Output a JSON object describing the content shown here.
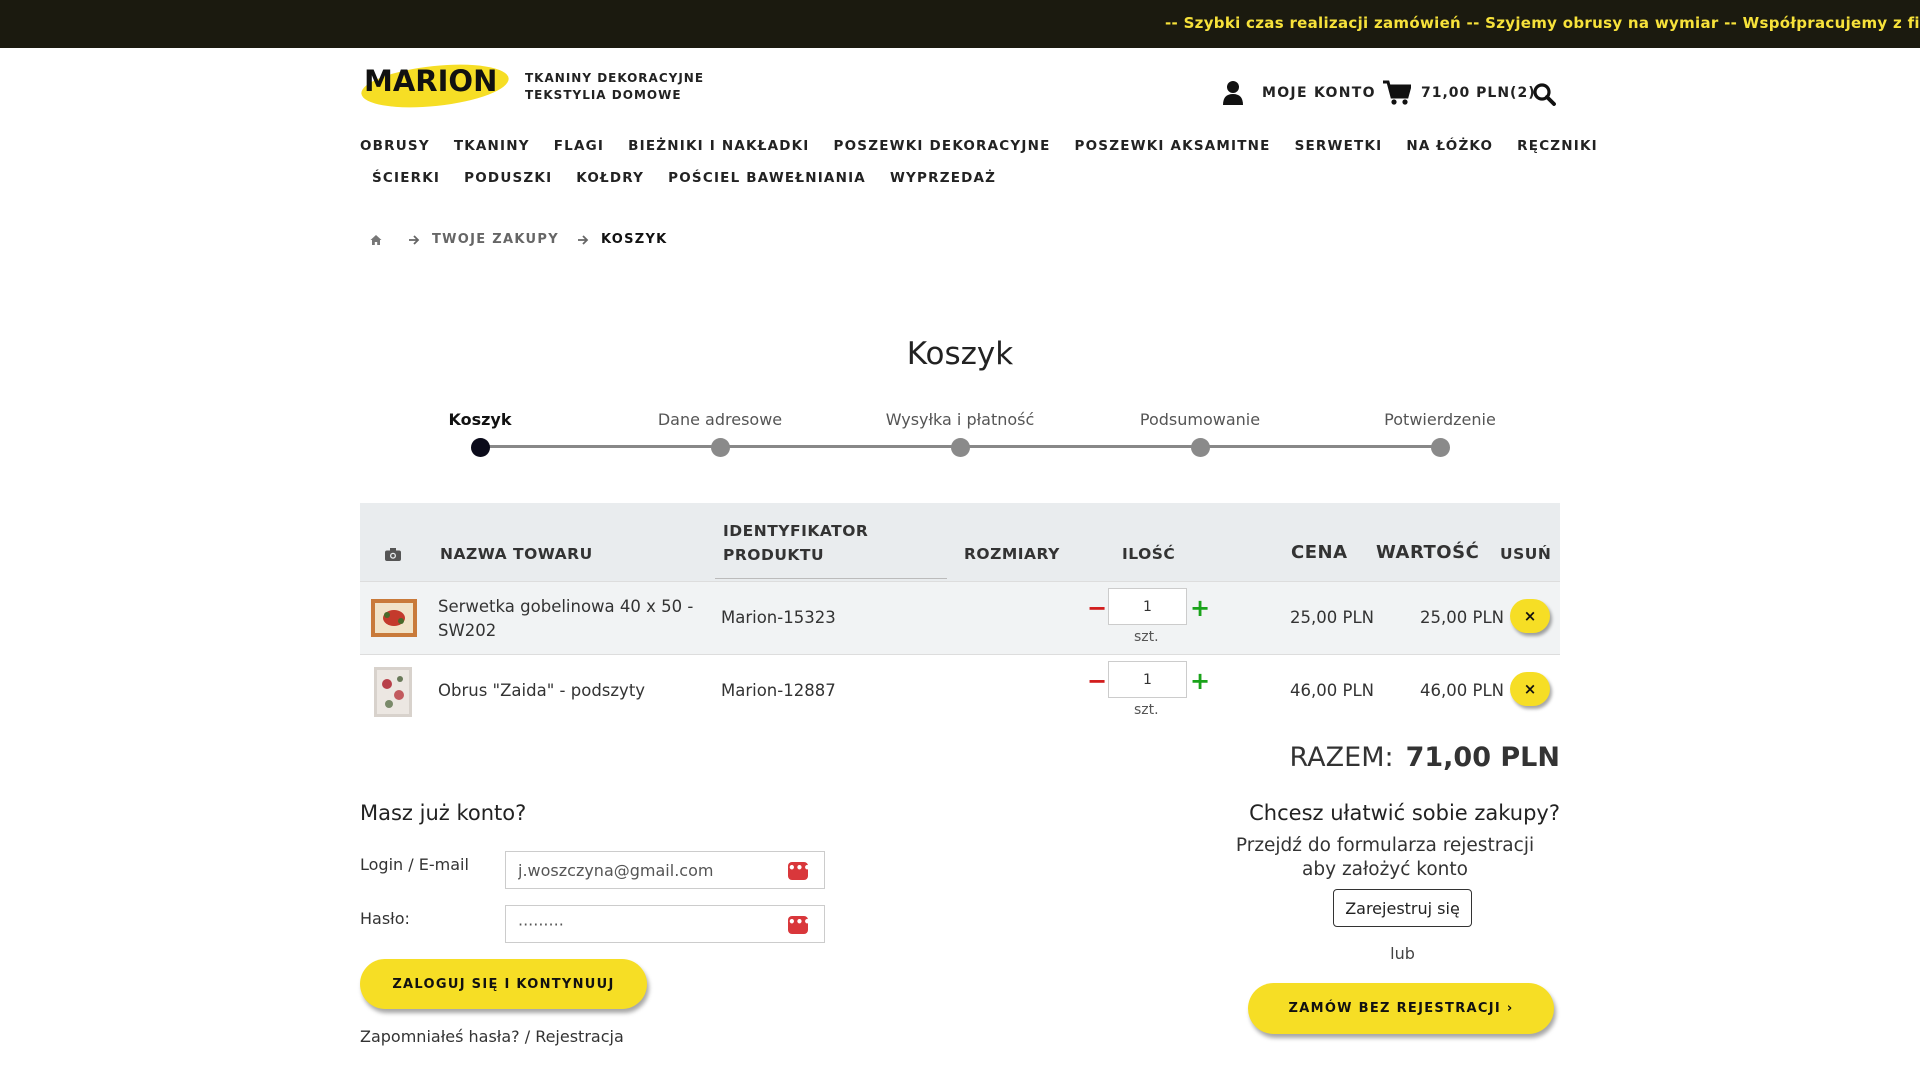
{
  "topbar": {
    "ticker": "--  Szybki czas realizacji zamówień  --  Szyjemy obrusy na wymiar  --  Współpracujemy z fir"
  },
  "header": {
    "logo_text": "MARION",
    "tagline_line1": "TKANINY DEKORACYJNE",
    "tagline_line2": "TEKSTYLIA DOMOWE",
    "account_label": "MOJE KONTO",
    "cart_label": "71,00 PLN(2)"
  },
  "nav": {
    "row1": [
      "OBRUSY",
      "TKANINY",
      "FLAGI",
      "BIEŻNIKI I NAKŁADKI",
      "POSZEWKI DEKORACYJNE",
      "POSZEWKI AKSAMITNE",
      "SERWETKI",
      "NA ŁÓŻKO",
      "RĘCZNIKI"
    ],
    "row2": [
      "ŚCIERKI",
      "PODUSZKI",
      "KOŁDRY",
      "POŚCIEL BAWEŁNIANIA",
      "WYPRZEDAŻ"
    ]
  },
  "breadcrumb": {
    "items": [
      "TWOJE ZAKUPY",
      "KOSZYK"
    ]
  },
  "page_title": "Koszyk",
  "steps": [
    "Koszyk",
    "Dane adresowe",
    "Wysyłka i płatność",
    "Podsumowanie",
    "Potwierdzenie"
  ],
  "table": {
    "headers": {
      "name": "NAZWA TOWARU",
      "id_line1": "IDENTYFIKATOR",
      "id_line2": "PRODUKTU",
      "sizes": "ROZMIARY",
      "qty": "ILOŚĆ",
      "price": "CENA",
      "value": "WARTOŚĆ",
      "remove": "USUŃ"
    },
    "rows": [
      {
        "name_line1": "Serwetka gobelinowa 40 x 50 -",
        "name_line2": "SW202",
        "product_id": "Marion-15323",
        "qty": "1",
        "unit": "szt.",
        "price": "25,00 PLN",
        "value": "25,00 PLN"
      },
      {
        "name_line1": "Obrus \"Zaida\" - podszyty",
        "name_line2": "",
        "product_id": "Marion-12887",
        "qty": "1",
        "unit": "szt.",
        "price": "46,00 PLN",
        "value": "46,00 PLN"
      }
    ],
    "remove_symbol": "×",
    "minus_symbol": "−",
    "plus_symbol": "+"
  },
  "total": {
    "label": "RAZEM:",
    "amount": "71,00 PLN"
  },
  "login": {
    "title": "Masz już konto?",
    "login_label": "Login / E-mail",
    "login_value": "j.woszczyna@gmail.com",
    "password_label": "Hasło:",
    "password_value": "·········",
    "submit_label": "ZALOGUJ SIĘ I KONTYNUUJ",
    "forgot_label": "Zapomniałeś hasła? / Rejestracja"
  },
  "register": {
    "title": "Chcesz ułatwić sobie zakupy?",
    "text_line1": "Przejdź do formularza rejestracji",
    "text_line2": "aby założyć konto",
    "register_label": "Zarejestruj się",
    "or_label": "lub",
    "guest_label": "ZAMÓW BEZ REJESTRACJI  ›"
  },
  "colors": {
    "accent_yellow": "#f6de25",
    "topbar_bg": "#1b1a0f",
    "minus_red": "#d21c1c",
    "plus_green": "#1aa31a"
  }
}
